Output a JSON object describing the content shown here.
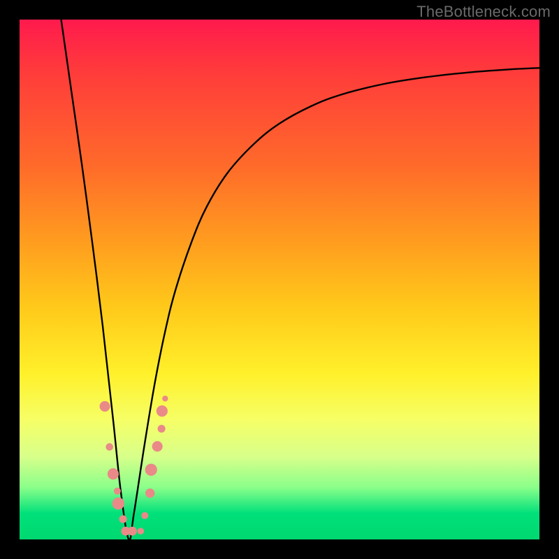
{
  "watermark": {
    "text": "TheBottleneck.com"
  },
  "colors": {
    "frame": "#000000",
    "curve": "#000000",
    "marker_fill": "#e98a88",
    "marker_stroke": "#c96a68",
    "gradient_top": "#ff1a4d",
    "gradient_bottom": "#00d870"
  },
  "chart_data": {
    "type": "line",
    "title": "",
    "xlabel": "",
    "ylabel": "",
    "xlim": [
      0,
      100
    ],
    "ylim": [
      0,
      100
    ],
    "notes": "V-shaped bottleneck curve. y≈100 means high bottleneck (red), y≈0 means no bottleneck (green). Minimum (optimal match) at x≈21. Axes are unlabeled; values estimated from pixel position within the 744×744 plot area.",
    "series": [
      {
        "name": "bottleneck-curve",
        "x": [
          8,
          10,
          12,
          14,
          16,
          18,
          19.5,
          21,
          22,
          24,
          26,
          28,
          30,
          33,
          36,
          40,
          45,
          50,
          56,
          62,
          70,
          78,
          86,
          94,
          100
        ],
        "y": [
          100,
          86,
          72,
          57,
          41,
          23,
          9,
          0,
          5,
          18,
          30,
          40,
          48,
          57,
          64,
          70.5,
          76,
          80,
          83.3,
          85.6,
          87.6,
          88.9,
          89.8,
          90.4,
          90.7
        ]
      }
    ],
    "markers": {
      "name": "highlighted-points",
      "note": "Pink markers clustered near the valley; sizes in plot-scale radius units.",
      "points": [
        {
          "x": 16.4,
          "y": 25.6,
          "r": 1.35
        },
        {
          "x": 17.3,
          "y": 17.8,
          "r": 0.95
        },
        {
          "x": 18.0,
          "y": 12.6,
          "r": 1.45
        },
        {
          "x": 18.8,
          "y": 9.3,
          "r": 0.9
        },
        {
          "x": 19.0,
          "y": 6.9,
          "r": 1.55
        },
        {
          "x": 19.9,
          "y": 3.9,
          "r": 1.0
        },
        {
          "x": 20.4,
          "y": 1.6,
          "r": 1.15
        },
        {
          "x": 21.7,
          "y": 1.6,
          "r": 1.15
        },
        {
          "x": 23.3,
          "y": 1.6,
          "r": 0.85
        },
        {
          "x": 24.1,
          "y": 4.6,
          "r": 0.9
        },
        {
          "x": 25.1,
          "y": 8.9,
          "r": 1.2
        },
        {
          "x": 25.3,
          "y": 13.4,
          "r": 1.55
        },
        {
          "x": 26.5,
          "y": 17.9,
          "r": 1.35
        },
        {
          "x": 27.3,
          "y": 21.3,
          "r": 1.0
        },
        {
          "x": 27.4,
          "y": 24.7,
          "r": 1.45
        },
        {
          "x": 28.0,
          "y": 27.1,
          "r": 0.75
        }
      ]
    }
  }
}
